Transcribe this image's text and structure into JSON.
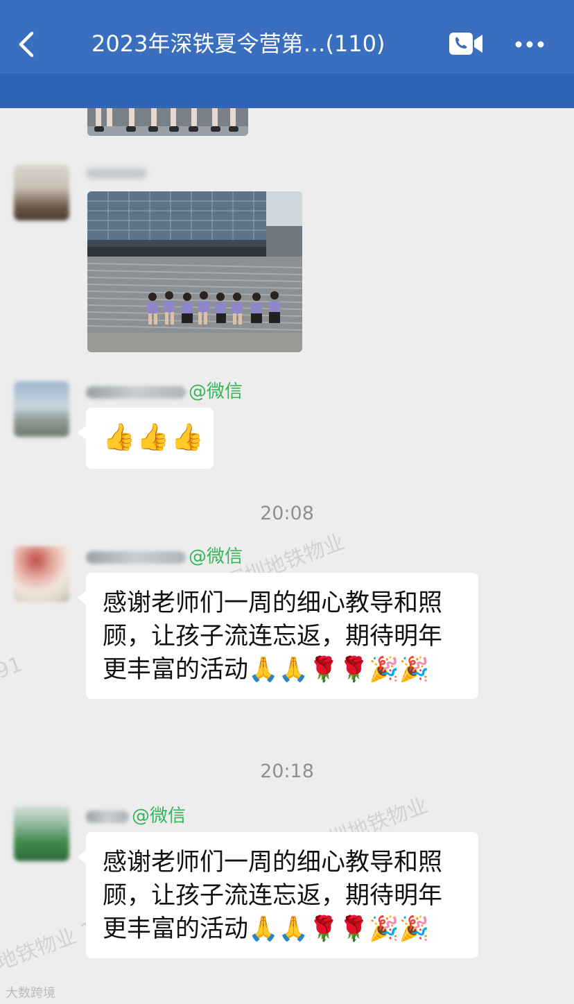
{
  "header": {
    "title": "2023年深铁夏令营第…(110)",
    "back_icon": "chevron-left-icon",
    "video_icon": "video-call-icon",
    "more_icon": "more-icon"
  },
  "messages": [
    {
      "type": "image",
      "image": "partial-group-photo"
    },
    {
      "type": "image",
      "image": "group-photo-stairs"
    },
    {
      "type": "text",
      "name_suffix": "@微信",
      "text": "👍👍👍"
    },
    {
      "type": "time",
      "text": "20:08"
    },
    {
      "type": "text",
      "name_suffix": "@微信",
      "text": "感谢老师们一周的细心教导和照顾，让孩子流连忘返，期待明年更丰富的活动🙏🙏🌹🌹🎉🎉"
    },
    {
      "type": "time",
      "text": "20:18"
    },
    {
      "type": "text",
      "name_suffix": "@微信",
      "text": "感谢老师们一周的细心教导和照顾，让孩子流连忘返，期待明年更丰富的活动🙏🙏🌹🌹🎉🎉"
    }
  ],
  "watermark": {
    "texts": [
      "深圳地铁物业",
      "深圳地铁物业",
      "地铁物业 12",
      "91"
    ],
    "brand": "大数跨境"
  },
  "colors": {
    "header_bg": "#3a6fbf",
    "chat_bg": "#ededed",
    "name_green": "#36b55a"
  }
}
